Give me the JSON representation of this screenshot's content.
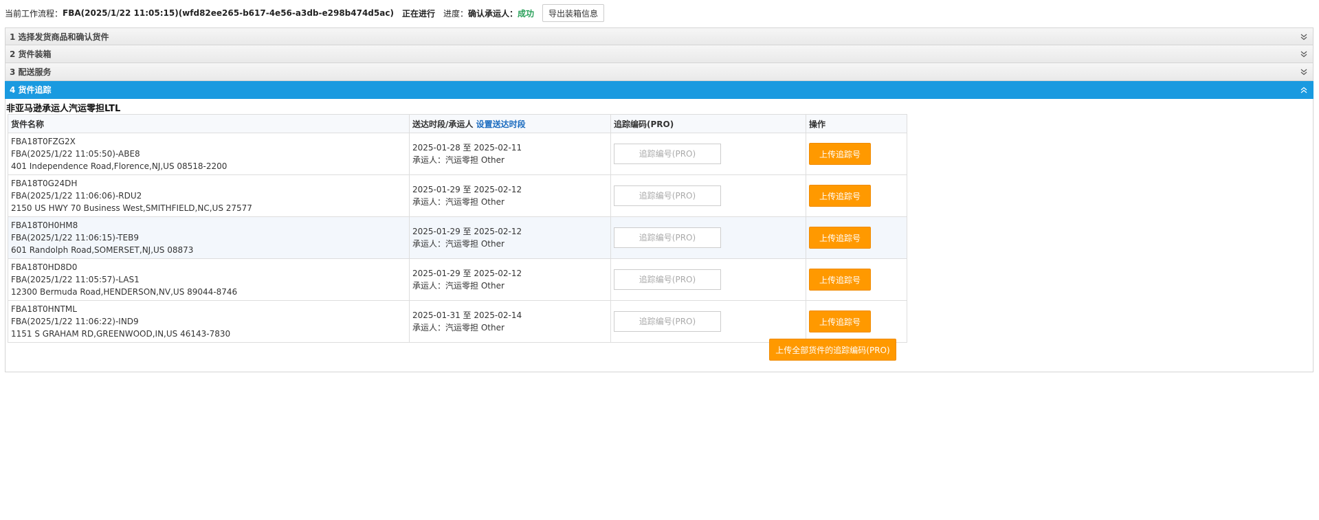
{
  "workflow": {
    "current_label": "当前工作流程：",
    "current_value": "FBA(2025/1/22 11:05:15)(wfd82ee265-b617-4e56-a3db-e298b474d5ac)",
    "status": "正在进行",
    "progress_label": "进度：",
    "progress_value": "确认承运人：",
    "result": "成功",
    "result_color": "#2aa05a",
    "export_label": "导出装箱信息"
  },
  "sections": [
    {
      "label": "1 选择发货商品和确认货件",
      "icon": "chevron-double-down-icon"
    },
    {
      "label": "2 货件装箱",
      "icon": "chevron-double-down-icon"
    },
    {
      "label": "3 配送服务",
      "icon": "chevron-double-down-icon"
    },
    {
      "label": "4 货件追踪",
      "icon": "chevron-double-up-icon"
    }
  ],
  "active_color": "#1a9ae0",
  "tracking": {
    "title": "非亚马逊承运人汽运零担LTL",
    "columns": {
      "name": "货件名称",
      "window": "送达时段/承运人",
      "window_link": "设置送达时段",
      "pro": "追踪编码(PRO)",
      "action": "操作"
    },
    "placeholder": "追踪编号(PRO)",
    "upload_label": "上传追踪号",
    "upload_all_label": "上传全部货件的追踪编码(PRO)",
    "button_color": "#ff9900",
    "rows": [
      {
        "id": "FBA18T0FZG2X",
        "name": "FBA(2025/1/22 11:05:50)-ABE8",
        "address": "401 Independence Road,Florence,NJ,US 08518-2200",
        "window": "2025-01-28 至 2025-02-11",
        "carrier": "承运人：汽运零担 Other"
      },
      {
        "id": "FBA18T0G24DH",
        "name": "FBA(2025/1/22 11:06:06)-RDU2",
        "address": "2150 US HWY 70 Business West,SMITHFIELD,NC,US 27577",
        "window": "2025-01-29 至 2025-02-12",
        "carrier": "承运人：汽运零担 Other"
      },
      {
        "id": "FBA18T0H0HM8",
        "name": "FBA(2025/1/22 11:06:15)-TEB9",
        "address": "601 Randolph Road,SOMERSET,NJ,US 08873",
        "window": "2025-01-29 至 2025-02-12",
        "carrier": "承运人：汽运零担 Other"
      },
      {
        "id": "FBA18T0HD8D0",
        "name": "FBA(2025/1/22 11:05:57)-LAS1",
        "address": "12300 Bermuda Road,HENDERSON,NV,US 89044-8746",
        "window": "2025-01-29 至 2025-02-12",
        "carrier": "承运人：汽运零担 Other"
      },
      {
        "id": "FBA18T0HNTML",
        "name": "FBA(2025/1/22 11:06:22)-IND9",
        "address": "1151 S GRAHAM RD,GREENWOOD,IN,US 46143-7830",
        "window": "2025-01-31 至 2025-02-14",
        "carrier": "承运人：汽运零担 Other"
      }
    ]
  }
}
